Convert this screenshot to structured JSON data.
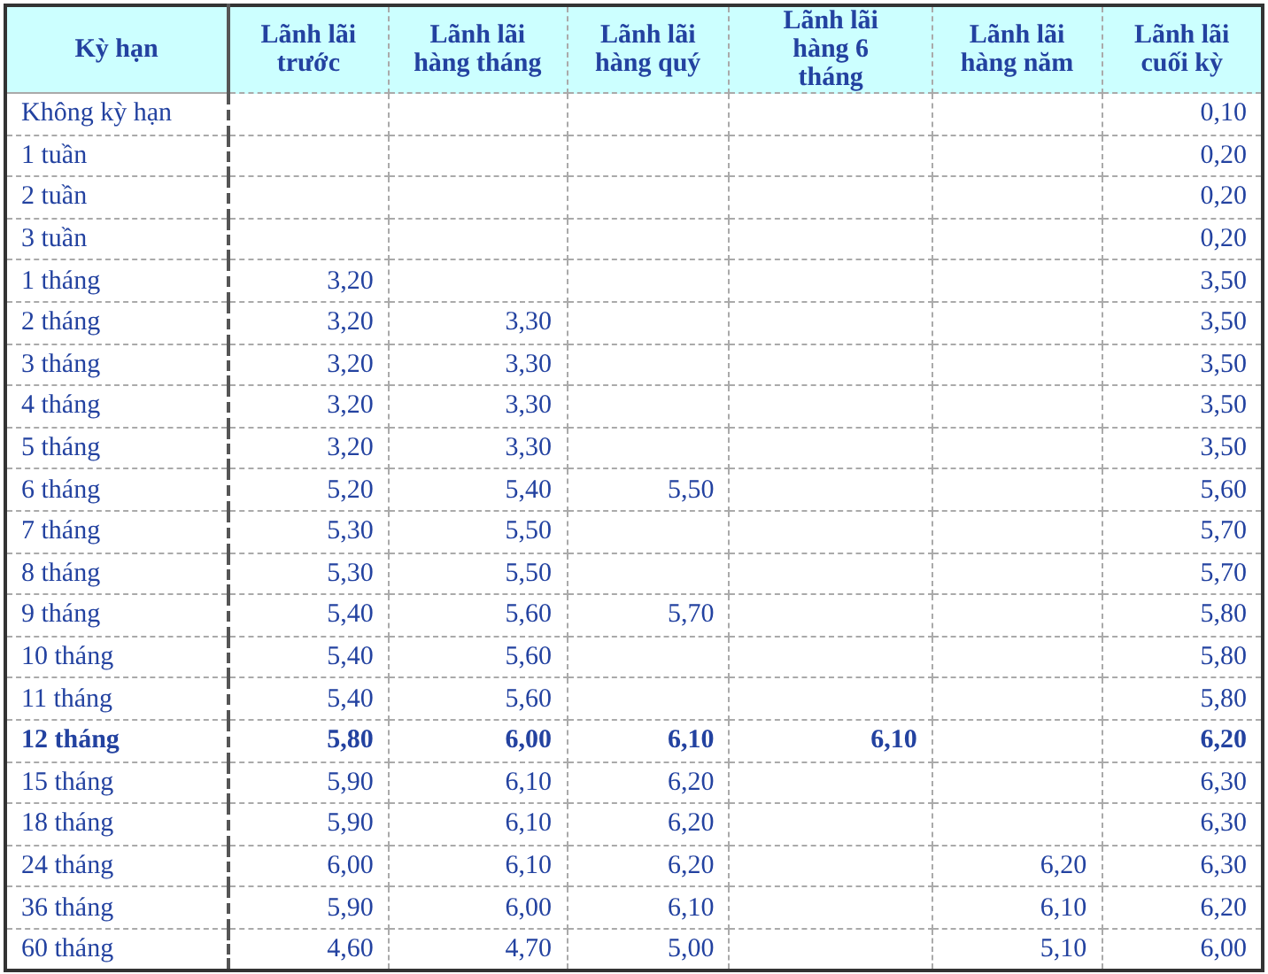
{
  "table": {
    "columns": [
      "Kỳ hạn",
      "Lãnh lãi trước",
      "Lãnh lãi hàng tháng",
      "Lãnh lãi hàng quý",
      "Lãnh lãi hàng 6 tháng",
      "Lãnh lãi hàng năm",
      "Lãnh lãi cuối kỳ"
    ],
    "rows": [
      {
        "term": "Không kỳ hạn",
        "bold": false,
        "maturity": "0,10"
      },
      {
        "term": "1 tuần",
        "bold": false,
        "maturity": "0,20"
      },
      {
        "term": "2 tuần",
        "bold": false,
        "maturity": "0,20"
      },
      {
        "term": "3 tuần",
        "bold": false,
        "maturity": "0,20"
      },
      {
        "term": "1 tháng",
        "bold": false,
        "prepaid": "3,20",
        "maturity": "3,50"
      },
      {
        "term": "2 tháng",
        "bold": false,
        "prepaid": "3,20",
        "monthly": "3,30",
        "maturity": "3,50"
      },
      {
        "term": "3 tháng",
        "bold": false,
        "prepaid": "3,20",
        "monthly": "3,30",
        "maturity": "3,50"
      },
      {
        "term": "4 tháng",
        "bold": false,
        "prepaid": "3,20",
        "monthly": "3,30",
        "maturity": "3,50"
      },
      {
        "term": "5 tháng",
        "bold": false,
        "prepaid": "3,20",
        "monthly": "3,30",
        "maturity": "3,50"
      },
      {
        "term": "6 tháng",
        "bold": false,
        "prepaid": "5,20",
        "monthly": "5,40",
        "quarterly": "5,50",
        "maturity": "5,60"
      },
      {
        "term": "7 tháng",
        "bold": false,
        "prepaid": "5,30",
        "monthly": "5,50",
        "maturity": "5,70"
      },
      {
        "term": "8 tháng",
        "bold": false,
        "prepaid": "5,30",
        "monthly": "5,50",
        "maturity": "5,70"
      },
      {
        "term": "9 tháng",
        "bold": false,
        "prepaid": "5,40",
        "monthly": "5,60",
        "quarterly": "5,70",
        "maturity": "5,80"
      },
      {
        "term": "10 tháng",
        "bold": false,
        "prepaid": "5,40",
        "monthly": "5,60",
        "maturity": "5,80"
      },
      {
        "term": "11 tháng",
        "bold": false,
        "prepaid": "5,40",
        "monthly": "5,60",
        "maturity": "5,80"
      },
      {
        "term": "12 tháng",
        "bold": true,
        "prepaid": "5,80",
        "monthly": "6,00",
        "quarterly": "6,10",
        "semiannual": "6,10",
        "maturity": "6,20"
      },
      {
        "term": "15 tháng",
        "bold": false,
        "prepaid": "5,90",
        "monthly": "6,10",
        "quarterly": "6,20",
        "maturity": "6,30"
      },
      {
        "term": "18 tháng",
        "bold": false,
        "prepaid": "5,90",
        "monthly": "6,10",
        "quarterly": "6,20",
        "maturity": "6,30"
      },
      {
        "term": "24 tháng",
        "bold": false,
        "prepaid": "6,00",
        "monthly": "6,10",
        "quarterly": "6,20",
        "annual": "6,20",
        "maturity": "6,30"
      },
      {
        "term": "36 tháng",
        "bold": false,
        "prepaid": "5,90",
        "monthly": "6,00",
        "quarterly": "6,10",
        "annual": "6,10",
        "maturity": "6,20"
      },
      {
        "term": "60 tháng",
        "bold": false,
        "prepaid": "4,60",
        "monthly": "4,70",
        "quarterly": "5,00",
        "annual": "5,10",
        "maturity": "6,00"
      }
    ]
  }
}
